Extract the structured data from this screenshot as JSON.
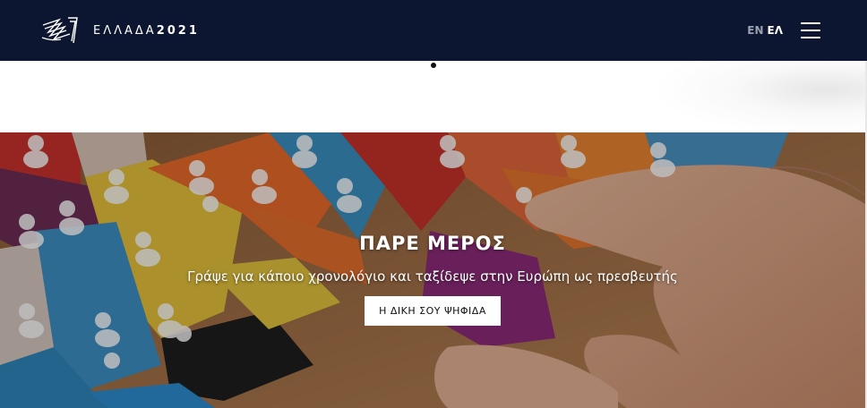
{
  "header": {
    "brand_name": "ΕΛΛΑΔΑ",
    "brand_year": "2021",
    "lang_en": "EN",
    "lang_el": "ΕΛ",
    "logo_icon": "greece-2021-logo-icon",
    "menu_icon": "hamburger-menu-icon",
    "background_color": "#0d1630"
  },
  "carousel": {
    "active_index": 1,
    "count": 1
  },
  "hero": {
    "title": "ΠΑΡΕ ΜΕΡΟΣ",
    "subtitle": "Γράψε για κάποιο χρονολόγιο και ταξίδεψε στην Ευρώπη ως πρεσβευτής",
    "button_label": "Η ΔΙΚΗ ΣΟΥ ΨΗΦΙΔΑ",
    "button_color": "#ffffff",
    "image": "colorful-puzzle-pieces-with-hand"
  }
}
